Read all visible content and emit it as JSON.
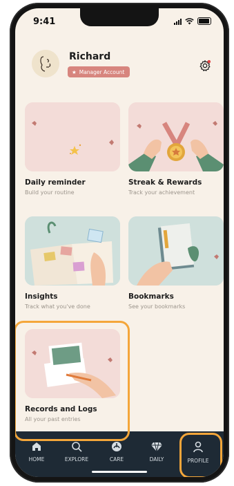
{
  "status": {
    "time": "9:41"
  },
  "profile": {
    "name": "Richard",
    "badge": "Manager Account"
  },
  "cards": [
    {
      "title": "Daily reminder",
      "subtitle": "Build your routine"
    },
    {
      "title": "Streak & Rewards",
      "subtitle": "Track your achievement"
    },
    {
      "title": "Insights",
      "subtitle": "Track what you've done"
    },
    {
      "title": "Bookmarks",
      "subtitle": "See your bookmarks"
    },
    {
      "title": "Records and Logs",
      "subtitle": "All your past entries"
    }
  ],
  "tabs": [
    {
      "label": "HOME",
      "icon": "home-icon"
    },
    {
      "label": "EXPLORE",
      "icon": "search-icon"
    },
    {
      "label": "CARE",
      "icon": "care-icon"
    },
    {
      "label": "DAILY",
      "icon": "diamond-icon"
    },
    {
      "label": "PROFILE",
      "icon": "person-icon"
    }
  ],
  "colors": {
    "background": "#f8f1e8",
    "accent": "#f4a63a",
    "badge": "#d7857e",
    "tabbar": "#1e2a35"
  }
}
